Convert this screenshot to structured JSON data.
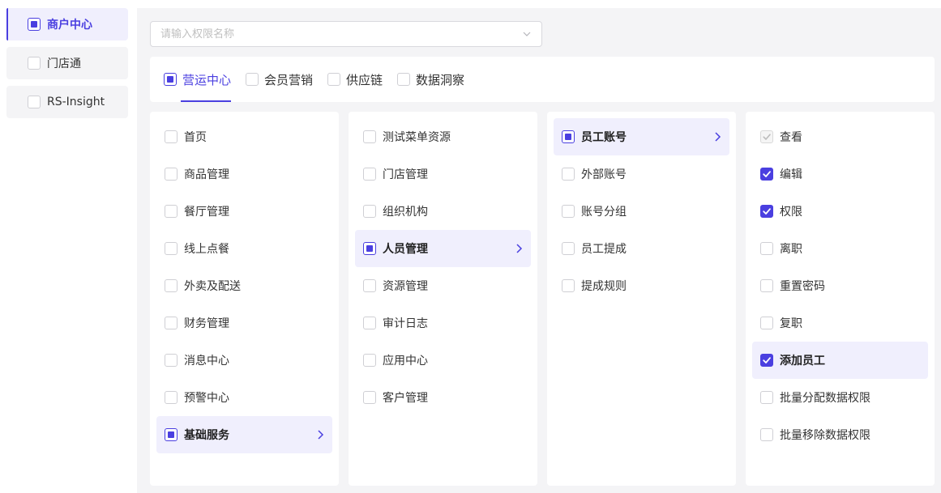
{
  "sidebar": {
    "items": [
      {
        "label": "商户中心",
        "state": "partial",
        "active": true
      },
      {
        "label": "门店通",
        "state": "none",
        "active": false
      },
      {
        "label": "RS-Insight",
        "state": "none",
        "active": false
      }
    ]
  },
  "search": {
    "placeholder": "请输入权限名称",
    "value": ""
  },
  "tabs": [
    {
      "label": "营运中心",
      "state": "partial",
      "active": true
    },
    {
      "label": "会员营销",
      "state": "none",
      "active": false
    },
    {
      "label": "供应链",
      "state": "none",
      "active": false
    },
    {
      "label": "数据洞察",
      "state": "none",
      "active": false
    }
  ],
  "columns": [
    {
      "items": [
        {
          "label": "首页",
          "state": "none",
          "active": false
        },
        {
          "label": "商品管理",
          "state": "none",
          "active": false
        },
        {
          "label": "餐厅管理",
          "state": "none",
          "active": false
        },
        {
          "label": "线上点餐",
          "state": "none",
          "active": false
        },
        {
          "label": "外卖及配送",
          "state": "none",
          "active": false
        },
        {
          "label": "财务管理",
          "state": "none",
          "active": false
        },
        {
          "label": "消息中心",
          "state": "none",
          "active": false
        },
        {
          "label": "预警中心",
          "state": "none",
          "active": false
        },
        {
          "label": "基础服务",
          "state": "partial",
          "active": true
        }
      ]
    },
    {
      "items": [
        {
          "label": "测试菜单资源",
          "state": "none",
          "active": false
        },
        {
          "label": "门店管理",
          "state": "none",
          "active": false
        },
        {
          "label": "组织机构",
          "state": "none",
          "active": false
        },
        {
          "label": "人员管理",
          "state": "partial",
          "active": true
        },
        {
          "label": "资源管理",
          "state": "none",
          "active": false
        },
        {
          "label": "审计日志",
          "state": "none",
          "active": false
        },
        {
          "label": "应用中心",
          "state": "none",
          "active": false
        },
        {
          "label": "客户管理",
          "state": "none",
          "active": false
        }
      ]
    },
    {
      "items": [
        {
          "label": "员工账号",
          "state": "partial",
          "active": true
        },
        {
          "label": "外部账号",
          "state": "none",
          "active": false
        },
        {
          "label": "账号分组",
          "state": "none",
          "active": false
        },
        {
          "label": "员工提成",
          "state": "none",
          "active": false
        },
        {
          "label": "提成规则",
          "state": "none",
          "active": false
        }
      ]
    },
    {
      "items": [
        {
          "label": "查看",
          "state": "disabled-checked",
          "active": false
        },
        {
          "label": "编辑",
          "state": "checked",
          "active": false
        },
        {
          "label": "权限",
          "state": "checked",
          "active": false
        },
        {
          "label": "离职",
          "state": "none",
          "active": false
        },
        {
          "label": "重置密码",
          "state": "none",
          "active": false
        },
        {
          "label": "复职",
          "state": "none",
          "active": false
        },
        {
          "label": "添加员工",
          "state": "checked",
          "active": true,
          "leaf": true
        },
        {
          "label": "批量分配数据权限",
          "state": "none",
          "active": false
        },
        {
          "label": "批量移除数据权限",
          "state": "none",
          "active": false
        }
      ]
    }
  ],
  "colors": {
    "accent": "#4a3fe0",
    "active_bg": "#f0effd",
    "panel_bg": "#f4f4f6"
  }
}
